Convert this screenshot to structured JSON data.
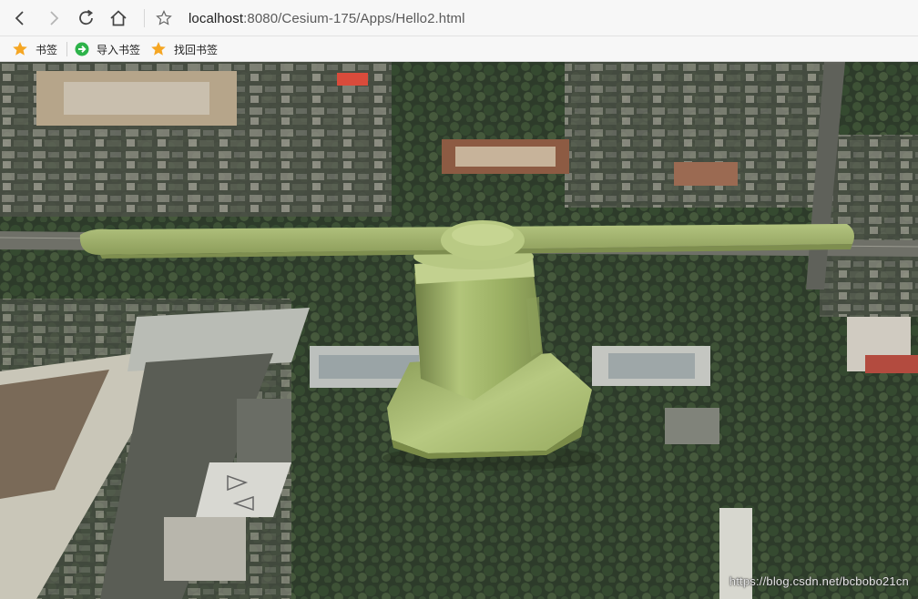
{
  "toolbar": {
    "back_icon": "arrow-left-icon",
    "forward_icon": "arrow-right-icon",
    "reload_icon": "reload-icon",
    "home_icon": "home-icon",
    "bookmark_star_icon": "star-outline-icon",
    "url_host": "localhost",
    "url_rest": ":8080/Cesium-175/Apps/Hello2.html"
  },
  "bookmarks_bar": {
    "items": [
      {
        "label": "书签",
        "icon": "star-icon",
        "color": "#f5a623"
      },
      {
        "label": "导入书签",
        "icon": "import-arrow-icon",
        "color": "#2db34a"
      },
      {
        "label": "找回书签",
        "icon": "star-icon",
        "color": "#f5a623"
      }
    ]
  },
  "viewer": {
    "scene": "satellite-imagery-with-3d-model",
    "model_color": "#a9bd6b",
    "watermark": "https://blog.csdn.net/bcbobo21cn"
  }
}
